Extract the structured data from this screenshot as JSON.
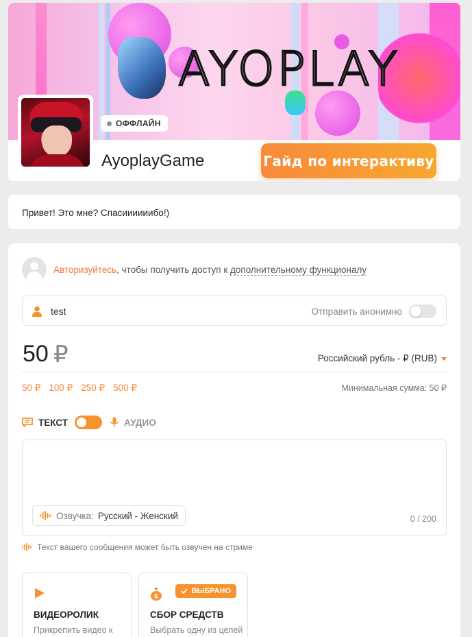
{
  "header": {
    "banner_logo_text": "AYOPLAY",
    "status_badge": "ОФФЛАЙН",
    "channel_name": "AyoplayGame",
    "guide_button_label": "Гайд по интерактиву"
  },
  "message": {
    "greeting": "Привет! Это мне? Спасиииииибо!)"
  },
  "auth": {
    "link_text": "Авторизуйтесь",
    "middle_text": ", чтобы получить доступ к ",
    "more_text": "дополнительному функционалу"
  },
  "name_field": {
    "value": "test",
    "anonymous_label": "Отправить анонимно"
  },
  "amount": {
    "value": "50",
    "currency_symbol": "₽",
    "currency_select": "Российский рубль - ₽ (RUB)",
    "quick_amounts": [
      "50 ₽",
      "100 ₽",
      "250 ₽",
      "500 ₽"
    ],
    "min_amount": "Минимальная сумма: 50 ₽"
  },
  "mode": {
    "text_label": "ТЕКСТ",
    "audio_label": "АУДИО"
  },
  "message_area": {
    "voice_label": "Озвучка:",
    "voice_value": "Русский - Женский",
    "char_count": "0 / 200",
    "hint": "Текст вашего сообщения может быть озвучен на стриме"
  },
  "features": [
    {
      "title": "ВИДЕОРОЛИК",
      "description": "Прикрепить видео к",
      "icon": "play-icon"
    },
    {
      "title": "СБОР СРЕДСТВ",
      "description": "Выбрать одну из целей",
      "icon": "money-bag-icon",
      "badge": "ВЫБРАНО"
    }
  ],
  "colors": {
    "accent": "#f7932f",
    "link": "#f27a3a"
  }
}
